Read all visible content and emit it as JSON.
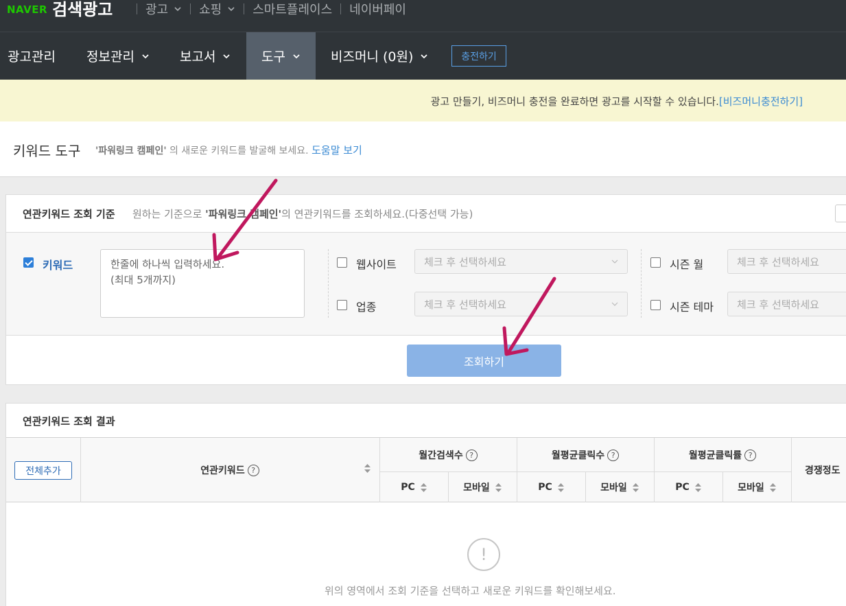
{
  "brand": {
    "logo": "NAVER",
    "title": "검색광고"
  },
  "topnav": [
    {
      "label": "광고",
      "dropdown": true
    },
    {
      "label": "쇼핑",
      "dropdown": true
    },
    {
      "label": "스마트플레이스",
      "dropdown": false
    },
    {
      "label": "네이버페이",
      "dropdown": false
    }
  ],
  "mainnav": {
    "items": [
      {
        "label": "광고관리"
      },
      {
        "label": "정보관리"
      },
      {
        "label": "보고서"
      },
      {
        "label": "도구"
      },
      {
        "label": "비즈머니 (0원)"
      }
    ],
    "active": "도구",
    "charge_label": "충전하기"
  },
  "notice": {
    "text": "광고 만들기, 비즈머니 충전을 완료하면 광고를 시작할 수 있습니다.",
    "link": "[비즈머니충전하기]"
  },
  "page": {
    "title": "키워드 도구",
    "campaign": "'파워링크 캠페인'",
    "subtitle_suffix": " 의 새로운 키워드를 발굴해 보세요. ",
    "help_link": "도움말 보기"
  },
  "criteria": {
    "title": "연관키워드 조회 기준",
    "desc_prefix": "원하는 기준으로 ",
    "desc_campaign": "'파워링크 캠페인'",
    "desc_suffix": "의 연관키워드를 조회하세요.(다중선택 가능)",
    "keyword_label": "키워드",
    "keyword_checked": true,
    "keyword_placeholder": "한줄에 하나씩 입력하세요.\n(최대 5개까지)",
    "website_label": "웹사이트",
    "industry_label": "업종",
    "season_month_label": "시즌 월",
    "season_theme_label": "시즌 테마",
    "select_placeholder": "체크 후 선택하세요",
    "search_button": "조회하기"
  },
  "results": {
    "title": "연관키워드 조회 결과",
    "add_all": "전체추가",
    "col_keyword": "연관키워드",
    "col_monthly_search": "월간검색수",
    "col_avg_clicks": "월평균클릭수",
    "col_avg_ctr": "월평균클릭률",
    "col_competition": "경쟁정도",
    "sub_pc": "PC",
    "sub_mobile": "모바일",
    "help_glyph": "?",
    "empty_glyph": "!",
    "empty_message": "위의 영역에서 조회 기준을 선택하고 새로운 키워드를 확인해보세요."
  },
  "colors": {
    "naver_green": "#1ec800",
    "nav_bg": "#2f3438",
    "active_tab": "#56606b",
    "link_blue": "#3a8ad3",
    "annotation_arrow": "#c0185e"
  }
}
